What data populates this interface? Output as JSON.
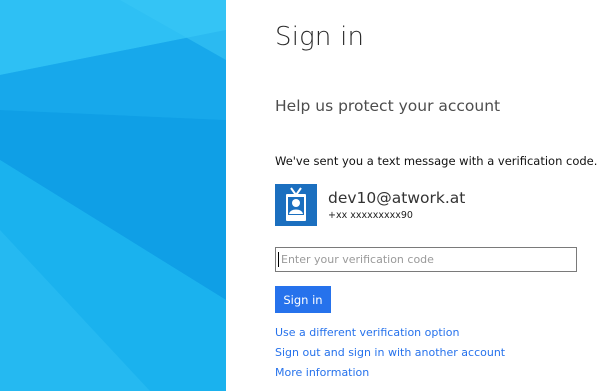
{
  "colors": {
    "hero_background": "#1fb0ee",
    "accent": "#2672ec",
    "avatar_background": "#1b6fbf"
  },
  "page": {
    "title": "Sign in",
    "subtitle": "Help us protect your account",
    "message": "We've sent you a text message with a verification code."
  },
  "account": {
    "email": "dev10@atwork.at",
    "phone": "+xx xxxxxxxxx90",
    "avatar_icon": "id-badge-icon"
  },
  "verification": {
    "placeholder": "Enter your verification code",
    "value": ""
  },
  "actions": {
    "signin_label": "Sign in"
  },
  "links": {
    "different_option": "Use a different verification option",
    "sign_out": "Sign out and sign in with another account",
    "more_info": "More information"
  }
}
